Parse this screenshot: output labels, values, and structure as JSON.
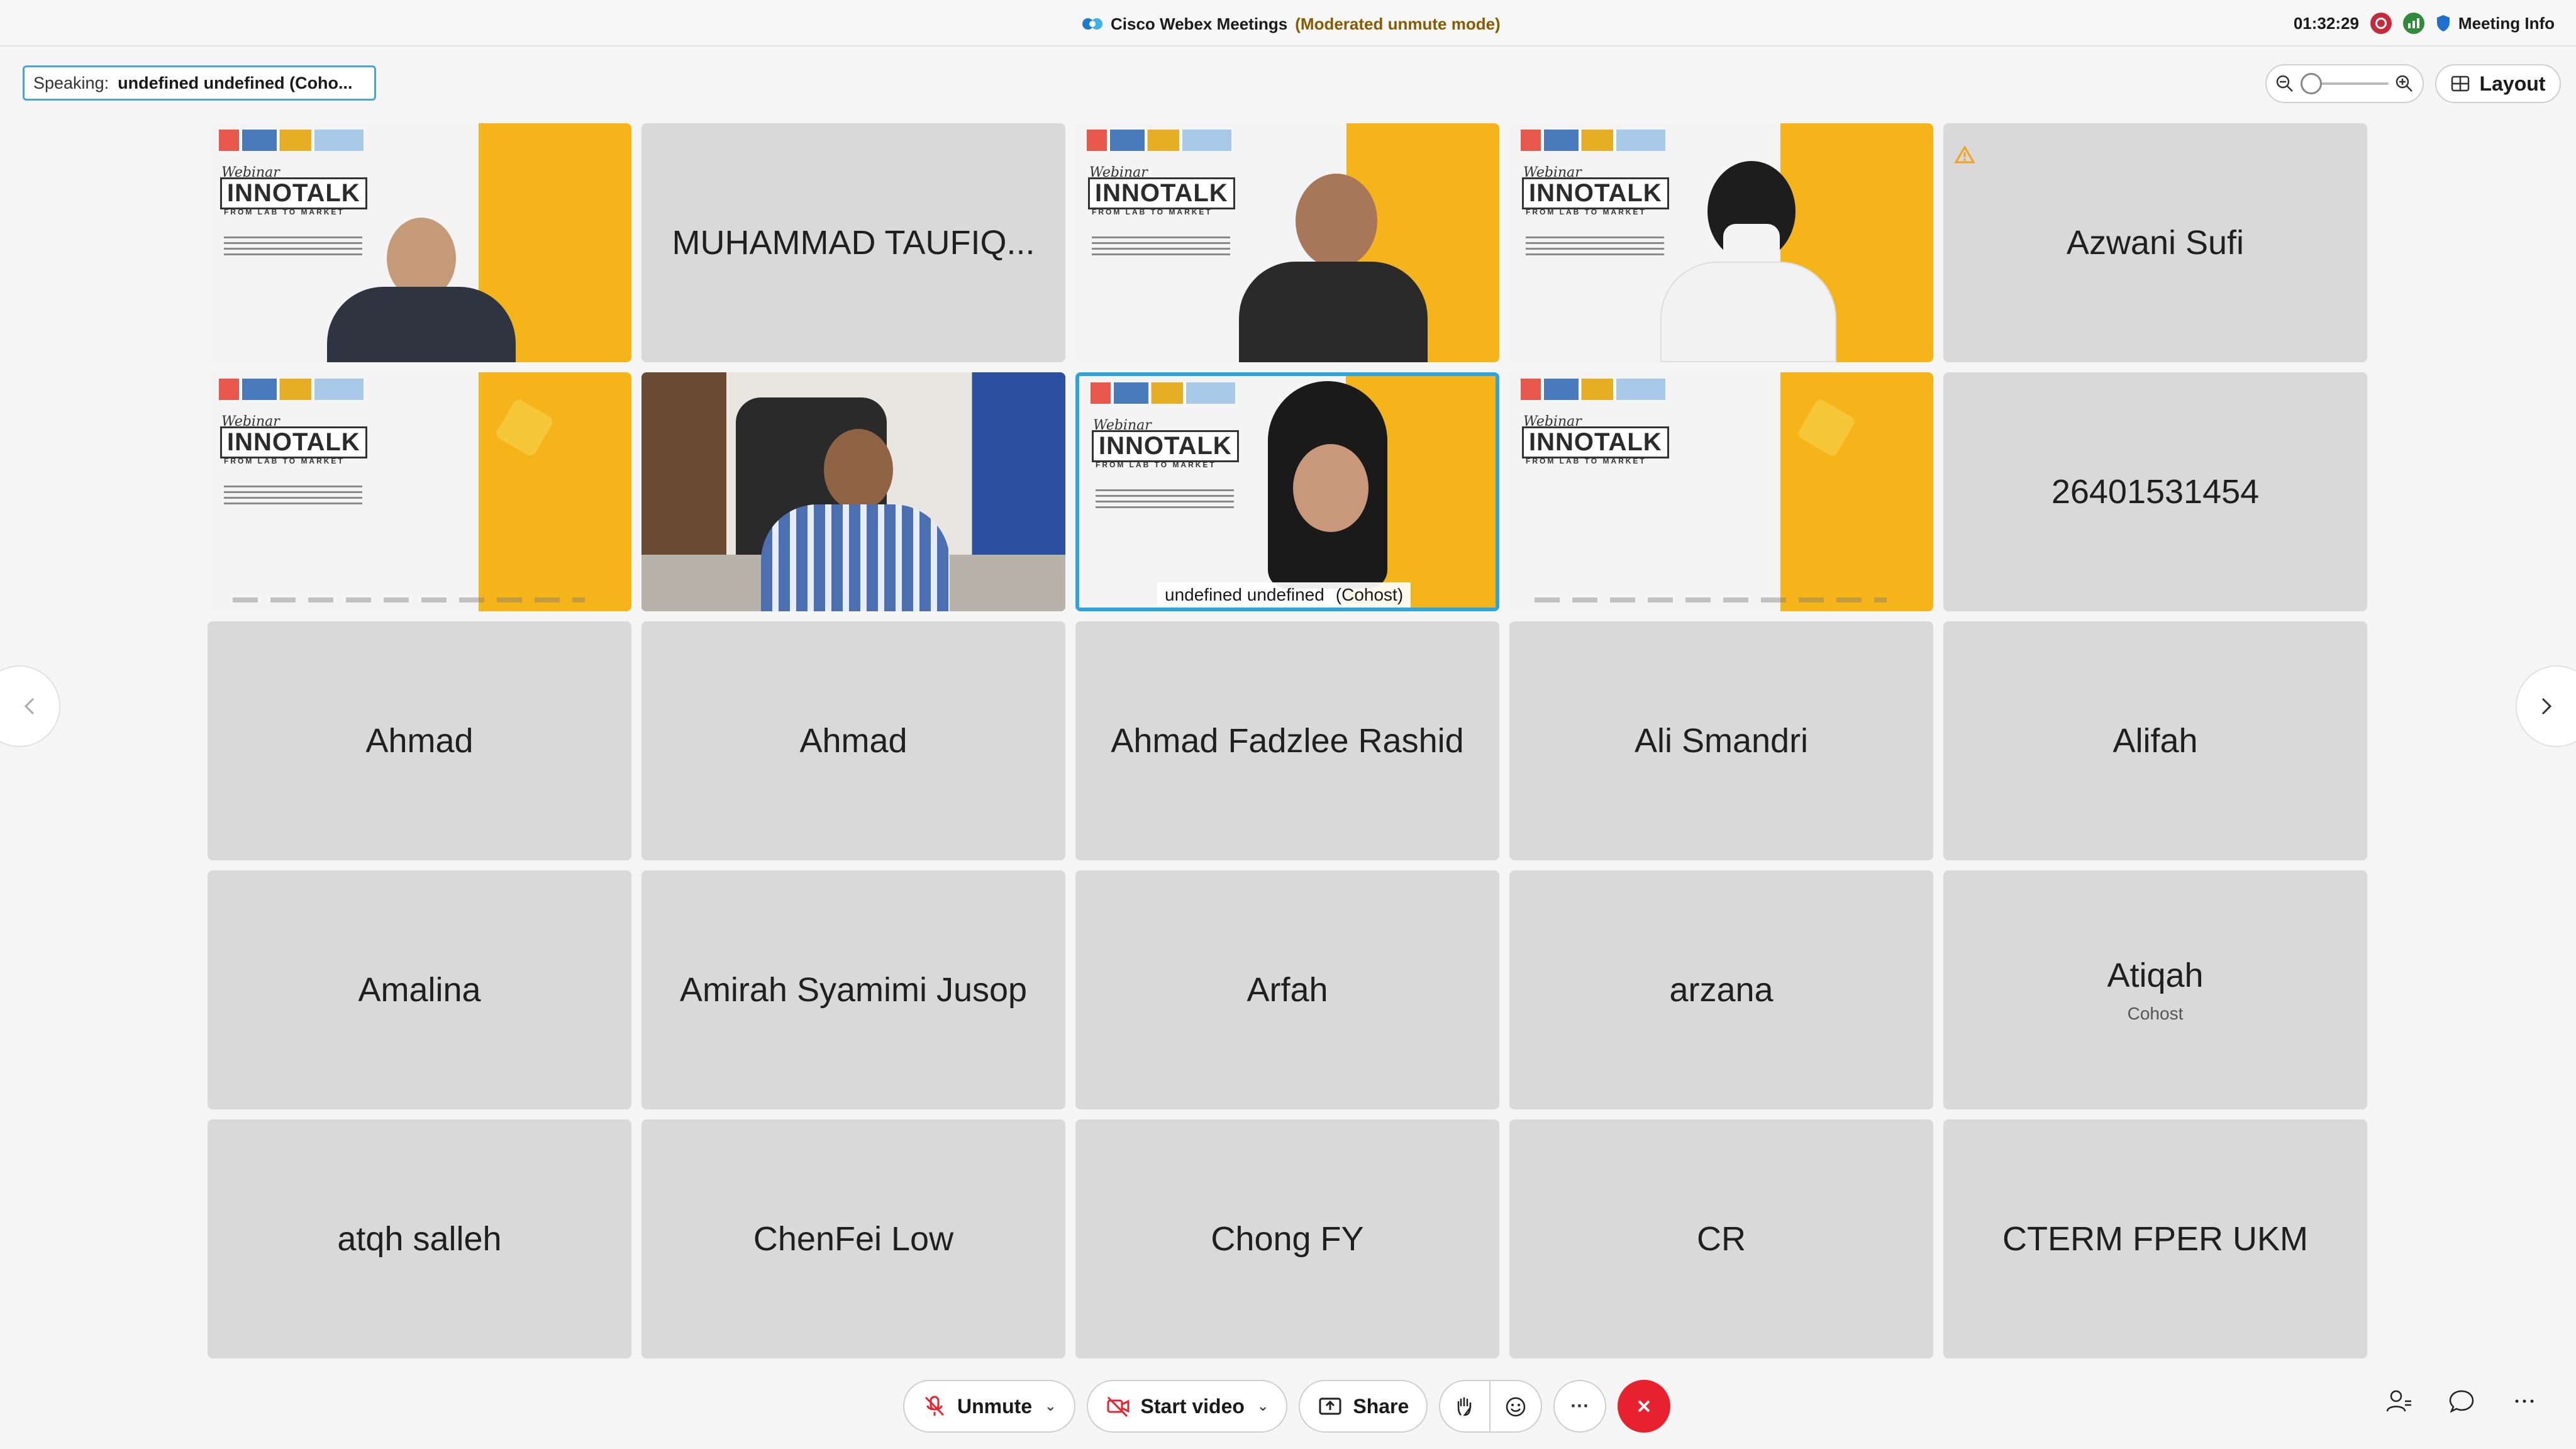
{
  "titlebar": {
    "app_name": "Cisco Webex Meetings",
    "mode": "(Moderated unmute mode)",
    "time": "01:32:29",
    "meeting_info": "Meeting Info"
  },
  "speaking": {
    "label": "Speaking:",
    "name": "undefined undefined (Coho..."
  },
  "layout_label": "Layout",
  "tiles": [
    {
      "type": "slide",
      "name": ""
    },
    {
      "type": "name",
      "name": "MUHAMMAD TAUFIQ..."
    },
    {
      "type": "slide",
      "name": ""
    },
    {
      "type": "slide",
      "name": ""
    },
    {
      "type": "name",
      "name": "Azwani Sufi"
    },
    {
      "type": "slide",
      "name": ""
    },
    {
      "type": "camera",
      "name": ""
    },
    {
      "type": "slide",
      "name": "undefined undefined",
      "role": "(Cohost)",
      "active": true
    },
    {
      "type": "slide",
      "name": ""
    },
    {
      "type": "name",
      "name": "26401531454"
    },
    {
      "type": "name",
      "name": "Ahmad"
    },
    {
      "type": "name",
      "name": "Ahmad"
    },
    {
      "type": "name",
      "name": "Ahmad Fadzlee Rashid"
    },
    {
      "type": "name",
      "name": "Ali Smandri"
    },
    {
      "type": "name",
      "name": "Alifah"
    },
    {
      "type": "name",
      "name": "Amalina"
    },
    {
      "type": "name",
      "name": "Amirah Syamimi Jusop"
    },
    {
      "type": "name",
      "name": "Arfah"
    },
    {
      "type": "name",
      "name": "arzana"
    },
    {
      "type": "name",
      "name": "Atiqah",
      "role": "Cohost"
    },
    {
      "type": "name",
      "name": "atqh salleh"
    },
    {
      "type": "name",
      "name": "ChenFei Low"
    },
    {
      "type": "name",
      "name": "Chong FY"
    },
    {
      "type": "name",
      "name": "CR"
    },
    {
      "type": "name",
      "name": "CTERM FPER UKM"
    }
  ],
  "slide": {
    "webinar": "Webinar",
    "innotalk": "INNOTALK",
    "from": "FROM LAB TO MARKET"
  },
  "nametiles": {
    "t1": "MUHAMMAD TAUFIQ...",
    "t4": "Azwani Sufi",
    "t9": "26401531454",
    "t10": "Ahmad",
    "t11": "Ahmad",
    "t12": "Ahmad Fadzlee Rashid",
    "t13": "Ali Smandri",
    "t14": "Alifah",
    "t15": "Amalina",
    "t16": "Amirah Syamimi Jusop",
    "t17": "Arfah",
    "t18": "arzana",
    "t19": "Atiqah",
    "t19_role": "Cohost",
    "t20": "atqh salleh",
    "t21": "ChenFei Low",
    "t22": "Chong FY",
    "t23": "CR",
    "t24": "CTERM FPER UKM",
    "t7_name": "undefined undefined",
    "t7_role": "(Cohost)"
  },
  "toolbar": {
    "unmute": "Unmute",
    "start_video": "Start video",
    "share": "Share",
    "more": "···"
  },
  "colors": {
    "accent": "#2ea3dc",
    "end_call": "#e8212e",
    "tile_bg": "#d9d9d9",
    "slide_yellow": "#f5b51a"
  }
}
